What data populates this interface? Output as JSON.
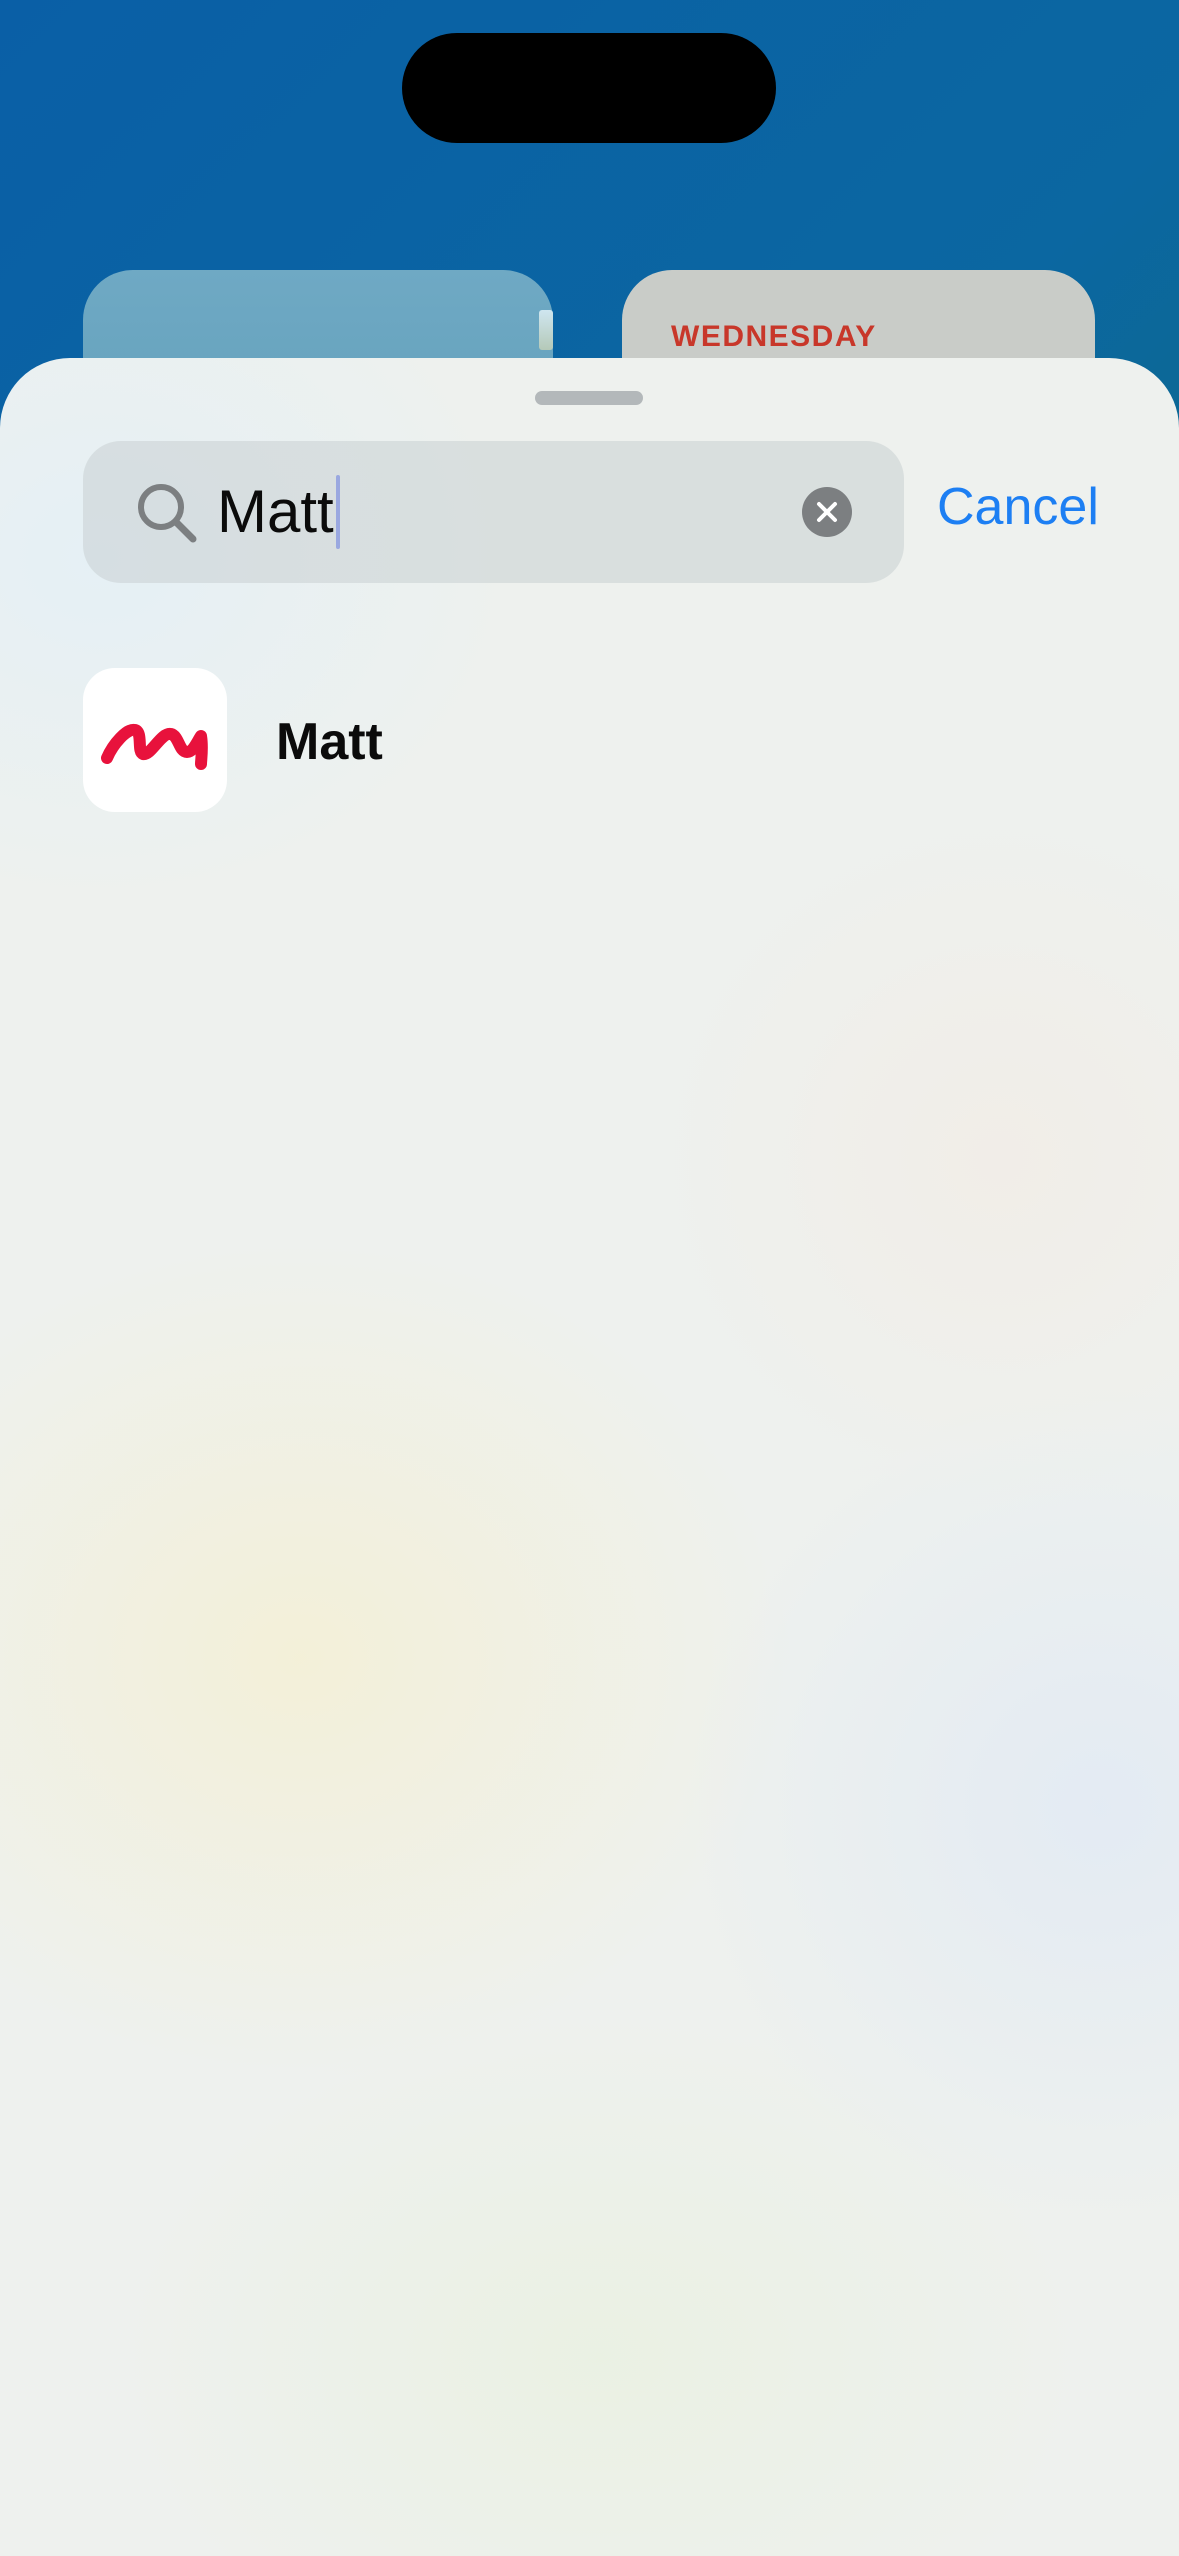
{
  "background_widgets": {
    "calendar_day": "WEDNESDAY"
  },
  "search": {
    "value": "Matt",
    "cancel_label": "Cancel"
  },
  "results": [
    {
      "name": "Matt",
      "icon": "handwritten-m-icon"
    }
  ],
  "colors": {
    "accent": "#1d7ff3",
    "calendar_red": "#c8372a",
    "app_icon_mark": "#e8123c"
  }
}
